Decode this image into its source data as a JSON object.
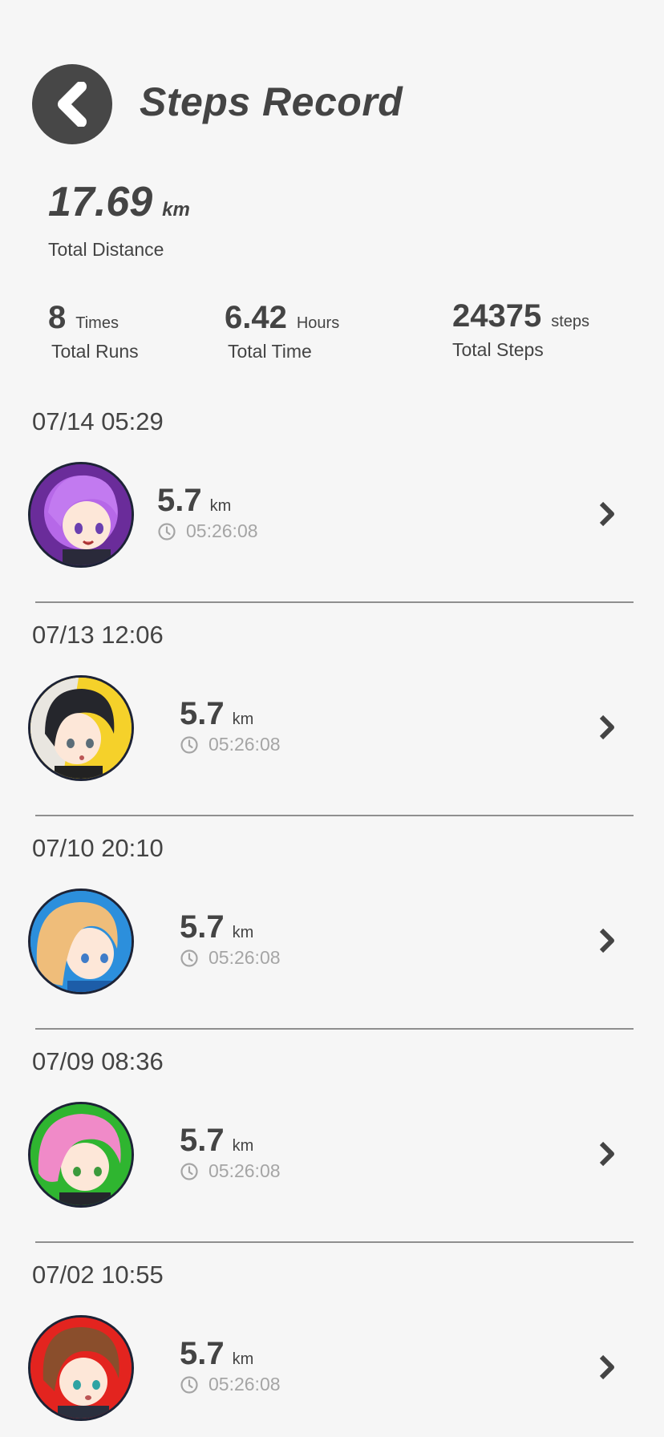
{
  "header": {
    "title": "Steps Record",
    "back_icon": "chevron-left-icon"
  },
  "summary": {
    "distance_value": "17.69",
    "distance_unit": "km",
    "distance_label": "Total Distance",
    "runs_value": "8",
    "runs_unit": "Times",
    "runs_label": "Total Runs",
    "time_value": "6.42",
    "time_unit": "Hours",
    "time_label": "Total Time",
    "steps_value": "24375",
    "steps_unit": "steps",
    "steps_label": "Total Steps"
  },
  "runs": [
    {
      "date": "07/14 05:29",
      "distance": "5.7",
      "unit": "km",
      "time": "05:26:08",
      "avatar": "purple-hair-character"
    },
    {
      "date": "07/13 12:06",
      "distance": "5.7",
      "unit": "km",
      "time": "05:26:08",
      "avatar": "black-hair-character"
    },
    {
      "date": "07/10 20:10",
      "distance": "5.7",
      "unit": "km",
      "time": "05:26:08",
      "avatar": "blonde-hair-character"
    },
    {
      "date": "07/09 08:36",
      "distance": "5.7",
      "unit": "km",
      "time": "05:26:08",
      "avatar": "pink-hair-character"
    },
    {
      "date": "07/02 10:55",
      "distance": "5.7",
      "unit": "km",
      "time": "05:26:08",
      "avatar": "brown-hair-character"
    }
  ],
  "colors": {
    "background": "#f6f6f6",
    "text": "#444444",
    "muted": "#a5a5a5",
    "back_button": "#474747"
  }
}
